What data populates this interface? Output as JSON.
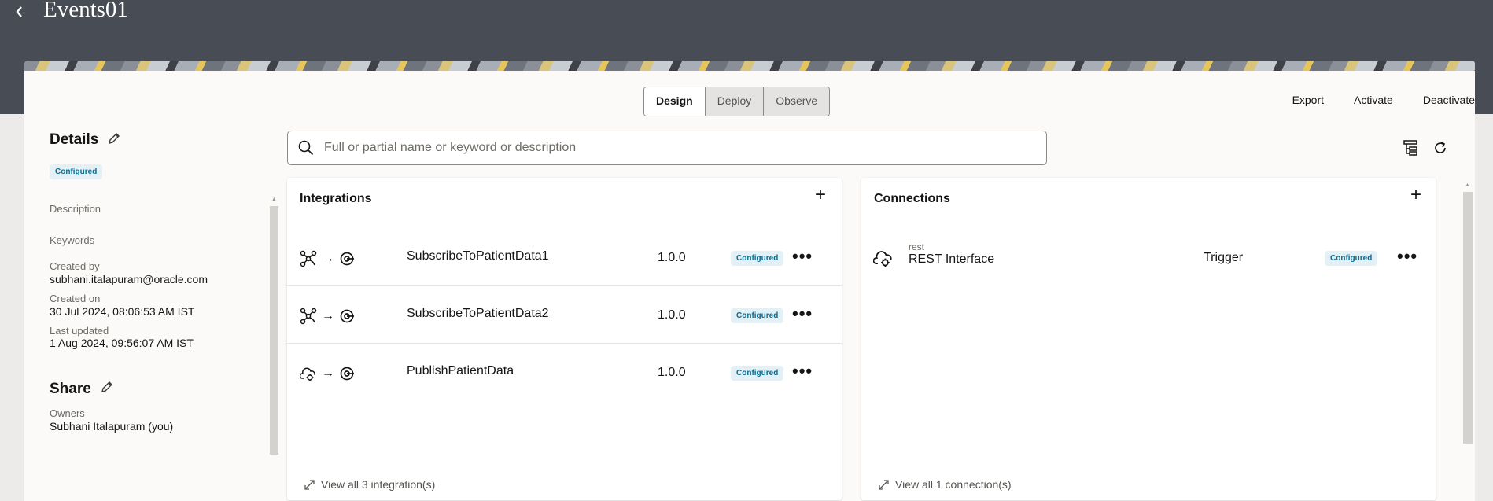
{
  "app": {
    "title": "Events01"
  },
  "mode_tabs": [
    "Design",
    "Deploy",
    "Observe"
  ],
  "actions": {
    "export": "Export",
    "activate": "Activate",
    "deactivate": "Deactivate"
  },
  "details": {
    "title": "Details",
    "status": "Configured",
    "description_label": "Description",
    "keywords_label": "Keywords",
    "created_by_label": "Created by",
    "created_by": "subhani.italapuram@oracle.com",
    "created_on_label": "Created on",
    "created_on": "30 Jul 2024, 08:06:53 AM IST",
    "last_updated_label": "Last updated",
    "last_updated": "1 Aug 2024, 09:56:07 AM IST"
  },
  "share": {
    "title": "Share",
    "owners_label": "Owners",
    "owners": "Subhani Italapuram (you)"
  },
  "search": {
    "placeholder": "Full or partial name or keyword or description",
    "value": ""
  },
  "integrations": {
    "title": "Integrations",
    "items": [
      {
        "name": "SubscribeToPatientData1",
        "version": "1.0.0",
        "status": "Configured",
        "source_icon": "event-network-icon"
      },
      {
        "name": "SubscribeToPatientData2",
        "version": "1.0.0",
        "status": "Configured",
        "source_icon": "event-network-icon"
      },
      {
        "name": "PublishPatientData",
        "version": "1.0.0",
        "status": "Configured",
        "source_icon": "cloud-gear-icon"
      }
    ],
    "view_all": "View all 3 integration(s)"
  },
  "connections": {
    "title": "Connections",
    "items": [
      {
        "type": "rest",
        "name": "REST Interface",
        "role": "Trigger",
        "status": "Configured"
      }
    ],
    "view_all": "View all 1 connection(s)"
  },
  "colors": {
    "topbar": "#484c54",
    "badge_bg": "#e3f0f6",
    "badge_text": "#0e6b8d"
  }
}
